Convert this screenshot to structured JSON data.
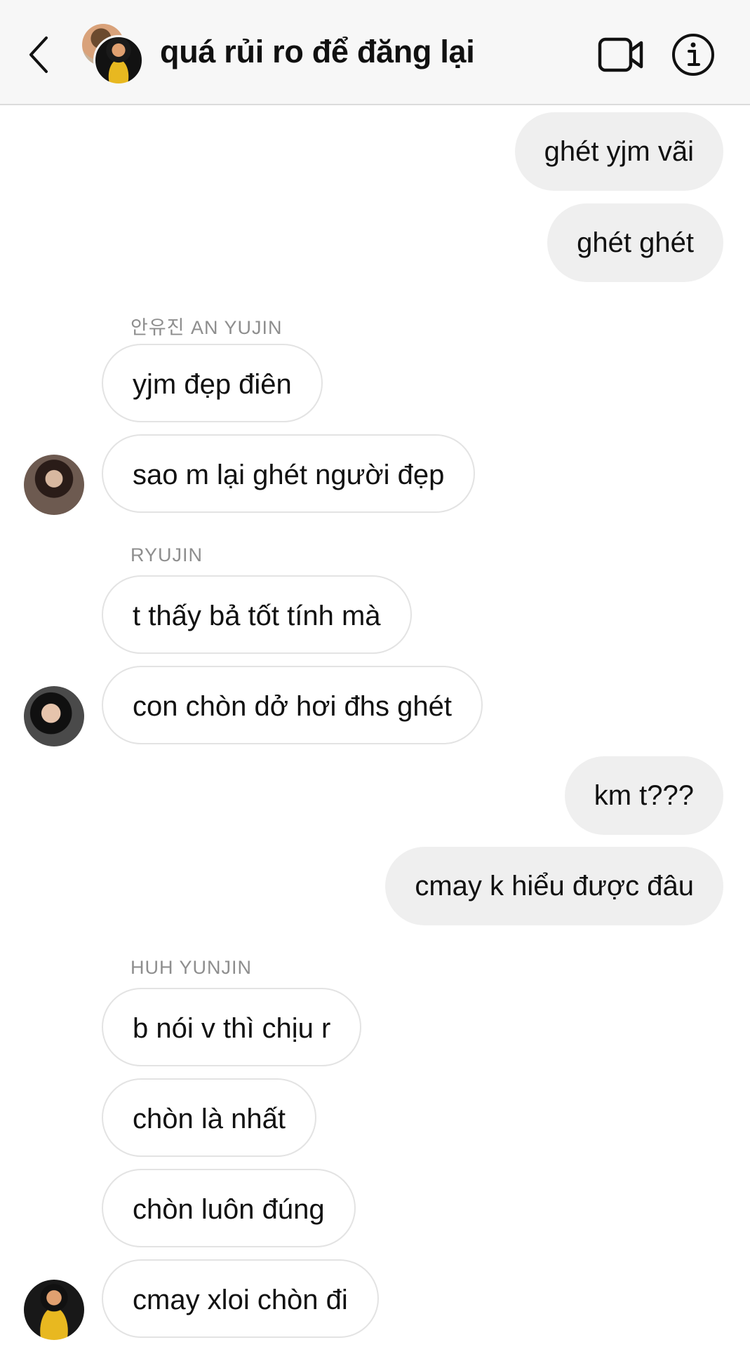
{
  "header": {
    "title": "quá rủi ro để đăng lại"
  },
  "messages": [
    {
      "text": "ghét yjm vãi"
    },
    {
      "text": "ghét ghét"
    },
    {
      "sender": "안유진 AN YUJIN"
    },
    {
      "text": "yjm đẹp điên"
    },
    {
      "text": "sao m lại ghét người đẹp"
    },
    {
      "sender": "RYUJIN"
    },
    {
      "text": "t thấy bả tốt tính mà"
    },
    {
      "text": "con chòn dở hơi đhs ghét"
    },
    {
      "text": "km t???"
    },
    {
      "text": "cmay k hiểu được đâu"
    },
    {
      "sender": "HUH YUNJIN"
    },
    {
      "text": "b nói v thì chịu r"
    },
    {
      "text": "chòn là nhất"
    },
    {
      "text": "chòn luôn đúng"
    },
    {
      "text": "cmay xloi chòn đi"
    }
  ],
  "colors": {
    "header_bg": "#f7f7f7",
    "outgoing_bubble": "#efefef",
    "incoming_border": "#e3e3e3",
    "sender_label": "#8e8e8e"
  },
  "icons": {
    "back": "chevron-left-icon",
    "video": "video-camera-icon",
    "info": "info-icon"
  }
}
